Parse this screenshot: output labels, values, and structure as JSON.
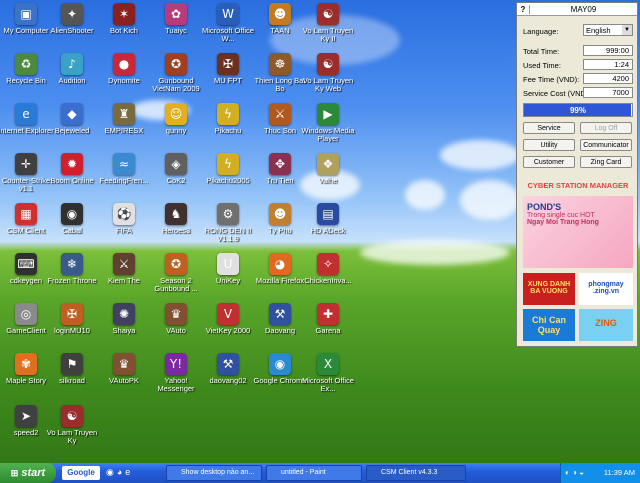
{
  "desktop": {
    "icons": [
      {
        "label": "My Computer",
        "icon": "computer-icon",
        "color": "#3b73c9",
        "glyph": "▣"
      },
      {
        "label": "AlienShooter",
        "icon": "gun-icon",
        "color": "#555555",
        "glyph": "✦"
      },
      {
        "label": "Bot Kich",
        "icon": "game-icon",
        "color": "#8a2020",
        "glyph": "✶"
      },
      {
        "label": "Tuaiyc",
        "icon": "game-icon",
        "color": "#b83b7d",
        "glyph": "✿"
      },
      {
        "label": "Microsoft Office W...",
        "icon": "word-icon",
        "color": "#2a5eb8",
        "glyph": "W"
      },
      {
        "label": "TAAN",
        "icon": "game-icon",
        "color": "#c47a23",
        "glyph": "☻"
      },
      {
        "label": "Vo Lam Truyen Ky II",
        "icon": "game-icon",
        "color": "#9b2d2d",
        "glyph": "☯"
      },
      {
        "label": "Recycle Bin",
        "icon": "recycle-bin-icon",
        "color": "#4c8a3f",
        "glyph": "♻"
      },
      {
        "label": "Audition",
        "icon": "game-icon",
        "color": "#3aa2c8",
        "glyph": "♪"
      },
      {
        "label": "Dynomite",
        "icon": "game-icon",
        "color": "#c8283a",
        "glyph": "●"
      },
      {
        "label": "Gunbound VietNam 2009",
        "icon": "game-icon",
        "color": "#a04020",
        "glyph": "✪"
      },
      {
        "label": "MU FPT",
        "icon": "game-icon",
        "color": "#6c3020",
        "glyph": "✠"
      },
      {
        "label": "Thien Long Bat Bo",
        "icon": "game-icon",
        "color": "#8d5a2b",
        "glyph": "☸"
      },
      {
        "label": "Vo Lam Truyen Ky Web",
        "icon": "game-icon",
        "color": "#9b2d2d",
        "glyph": "☯"
      },
      {
        "label": "Internet Explorer",
        "icon": "internet-explorer-icon",
        "color": "#2a7ad8",
        "glyph": "e"
      },
      {
        "label": "Bejeweled",
        "icon": "game-icon",
        "color": "#3a6fd0",
        "glyph": "◆"
      },
      {
        "label": "EMPIRESX",
        "icon": "game-icon",
        "color": "#7a6a40",
        "glyph": "♜"
      },
      {
        "label": "gunny",
        "icon": "game-icon",
        "color": "#e0b020",
        "glyph": "☺"
      },
      {
        "label": "Pikachu",
        "icon": "game-icon",
        "color": "#d0b020",
        "glyph": "ϟ"
      },
      {
        "label": "Thuc Son",
        "icon": "game-icon",
        "color": "#b05a20",
        "glyph": "⚔"
      },
      {
        "label": "Windows Media Player",
        "icon": "media-player-icon",
        "color": "#2a8a3a",
        "glyph": "▶"
      },
      {
        "label": "Counter-Strike v1.1",
        "icon": "game-icon",
        "color": "#404040",
        "glyph": "✛"
      },
      {
        "label": "Boom Online",
        "icon": "game-icon",
        "color": "#d02030",
        "glyph": "✹"
      },
      {
        "label": "FeedingFren...",
        "icon": "game-icon",
        "color": "#3a8ad0",
        "glyph": "≈"
      },
      {
        "label": "CoK2",
        "icon": "game-icon",
        "color": "#606060",
        "glyph": "◈"
      },
      {
        "label": "Pikachu2005",
        "icon": "game-icon",
        "color": "#d0b020",
        "glyph": "ϟ"
      },
      {
        "label": "Tru Tien",
        "icon": "game-icon",
        "color": "#8a3050",
        "glyph": "✥"
      },
      {
        "label": "Valhe",
        "icon": "game-icon",
        "color": "#b0a060",
        "glyph": "❖"
      },
      {
        "label": "CSM Client",
        "icon": "csm-client-icon",
        "color": "#d03030",
        "glyph": "▦"
      },
      {
        "label": "Cabal",
        "icon": "game-icon",
        "color": "#303030",
        "glyph": "◉"
      },
      {
        "label": "FIFA",
        "icon": "game-icon",
        "color": "#e0e0e0",
        "glyph": "⚽"
      },
      {
        "label": "Heroes3",
        "icon": "game-icon",
        "color": "#403030",
        "glyph": "♞"
      },
      {
        "label": "RONG DEN II V1.1.9",
        "icon": "game-icon",
        "color": "#707070",
        "glyph": "⚙"
      },
      {
        "label": "Ty Phu",
        "icon": "game-icon",
        "color": "#c08030",
        "glyph": "☻"
      },
      {
        "label": "HD ADeck",
        "icon": "game-icon",
        "color": "#2a4aa0",
        "glyph": "▤"
      },
      {
        "label": "cdkeygen",
        "icon": "tool-icon",
        "color": "#303030",
        "glyph": "⌨"
      },
      {
        "label": "Frozen Throne",
        "icon": "game-icon",
        "color": "#3a5a8a",
        "glyph": "❄"
      },
      {
        "label": "Kiem The",
        "icon": "game-icon",
        "color": "#604030",
        "glyph": "⚔"
      },
      {
        "label": "Season 2 Gunbound ...",
        "icon": "game-icon",
        "color": "#c06020",
        "glyph": "✪"
      },
      {
        "label": "UniKey",
        "icon": "keyboard-icon",
        "color": "#e0e0e0",
        "glyph": "U"
      },
      {
        "label": "Mozilla Firefox",
        "icon": "firefox-icon",
        "color": "#e06a20",
        "glyph": "◕"
      },
      {
        "label": "ChickenInva...",
        "icon": "game-icon",
        "color": "#c03030",
        "glyph": "✧"
      },
      {
        "label": "GameClient",
        "icon": "game-icon",
        "color": "#8a8a8a",
        "glyph": "◎"
      },
      {
        "label": "loginMU10",
        "icon": "game-icon",
        "color": "#c06020",
        "glyph": "✠"
      },
      {
        "label": "Shaiya",
        "icon": "game-icon",
        "color": "#404060",
        "glyph": "✺"
      },
      {
        "label": "VAuto",
        "icon": "game-icon",
        "color": "#805030",
        "glyph": "♛"
      },
      {
        "label": "VietKey 2000",
        "icon": "keyboard-icon",
        "color": "#c03030",
        "glyph": "V"
      },
      {
        "label": "Daovang",
        "icon": "game-icon",
        "color": "#3050a0",
        "glyph": "⚒"
      },
      {
        "label": "Garena",
        "icon": "game-icon",
        "color": "#c03030",
        "glyph": "✚"
      },
      {
        "label": "Maple Story",
        "icon": "game-icon",
        "color": "#e07020",
        "glyph": "✾"
      },
      {
        "label": "silkroad",
        "icon": "game-icon",
        "color": "#404040",
        "glyph": "⚑"
      },
      {
        "label": "VAutoPK",
        "icon": "game-icon",
        "color": "#805030",
        "glyph": "♛"
      },
      {
        "label": "Yahoo! Messenger",
        "icon": "yahoo-messenger-icon",
        "color": "#7a2aa0",
        "glyph": "Y!"
      },
      {
        "label": "daovang02",
        "icon": "game-icon",
        "color": "#3050a0",
        "glyph": "⚒"
      },
      {
        "label": "Google Chrome",
        "icon": "chrome-icon",
        "color": "#2a8ad0",
        "glyph": "◉"
      },
      {
        "label": "Microsoft Office Ex...",
        "icon": "excel-icon",
        "color": "#2a8a3a",
        "glyph": "X"
      },
      {
        "label": "speed2",
        "icon": "game-icon",
        "color": "#404040",
        "glyph": "➤"
      },
      {
        "label": "Vo Lam Truyen Ky",
        "icon": "game-icon",
        "color": "#9b2d2d",
        "glyph": "☯"
      }
    ]
  },
  "csm": {
    "title": "MAY09",
    "help": "?",
    "language_label": "Language:",
    "language_value": "English",
    "total_time_label": "Total Time:",
    "total_time_value": "999:00",
    "used_time_label": "Used Time:",
    "used_time_value": "1:24",
    "fee_time_label": "Fee Time (VND):",
    "fee_time_value": "4200",
    "service_cost_label": "Service Cost (VND):",
    "service_cost_value": "7000",
    "progress_text": "99%",
    "progress_value": 0.99,
    "buttons": {
      "service": "Service",
      "logoff": "Log Off",
      "utility": "Utility",
      "communicator": "Communicator",
      "customer": "Customer",
      "zing_card": "Zing Card"
    },
    "brand": "CYBER STATION MANAGER",
    "ads": {
      "ponds_title": "POND'S",
      "ponds_line1": "Trong single cuc HOT",
      "ponds_line2": "Ngay Moi Trang Hong",
      "ad1": "XUNG DANH BA VUONG",
      "ad2": "phongmay .zing.vn",
      "ad3": "Chi Can Quay",
      "ad4": "ZING"
    }
  },
  "taskbar": {
    "start": "start",
    "google": "Google",
    "tasks": [
      {
        "label": "Show desktop nào an..."
      },
      {
        "label": "untitled - Paint"
      },
      {
        "label": "CSM Client v4.3.3"
      }
    ],
    "clock": "11:39 AM"
  }
}
